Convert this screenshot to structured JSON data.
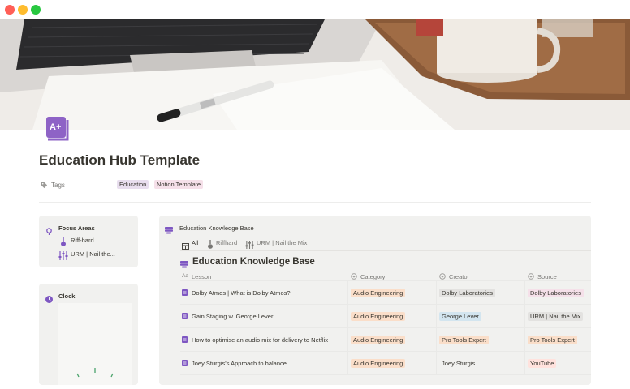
{
  "window": {
    "controls": [
      "close",
      "minimize",
      "maximize"
    ]
  },
  "colors": {
    "close": "#ff5f57",
    "minimize": "#febc2e",
    "maximize": "#28c840",
    "accent_purple": "#7e57c2",
    "tag_education": "#e8deee",
    "tag_notion": "#f5e0e9",
    "pill_orange": "#fadec9",
    "pill_gray": "#e3e2e0",
    "pill_blue": "#d3e5ef",
    "pill_red": "#ffe2dd",
    "pill_pink": "#f5e0e9"
  },
  "page": {
    "icon": "a-plus-book-icon",
    "title": "Education Hub Template",
    "tags_label": "Tags",
    "tags": [
      "Education",
      "Notion Template"
    ]
  },
  "focus": {
    "title": "Focus Areas",
    "items": [
      "Riff-hard",
      "URM | Nail the..."
    ]
  },
  "clock": {
    "title": "Clock"
  },
  "kb": {
    "header": "Education Knowledge Base",
    "views": [
      "All",
      "Riffhard",
      "URM | Nail the Mix"
    ],
    "title": "Education Knowledge Base",
    "columns": [
      "Lesson",
      "Category",
      "Creator",
      "Source"
    ],
    "rows": [
      {
        "lesson": "Dolby Atmos | What is Dolby Atmos?",
        "category": "Audio Engineering",
        "creator": "Dolby Laboratories",
        "source": "Dolby Laboratories"
      },
      {
        "lesson": "Gain Staging w. George Lever",
        "category": "Audio Engineering",
        "creator": "George Lever",
        "source": "URM | Nail the Mix"
      },
      {
        "lesson": "How to optimise an audio mix for delivery to Netflix",
        "category": "Audio Engineering",
        "creator": "Pro Tools Expert",
        "source": "Pro Tools Expert"
      },
      {
        "lesson": "Joey Sturgis's Approach to balance",
        "category": "Audio Engineering",
        "creator": "Joey Sturgis",
        "source": "YouTube"
      }
    ]
  }
}
